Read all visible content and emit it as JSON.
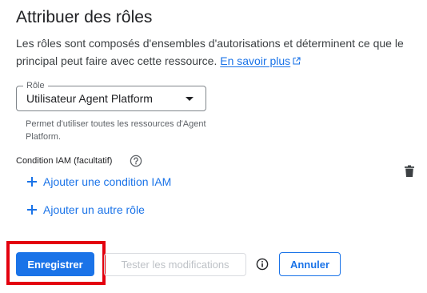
{
  "dialog": {
    "title": "Attribuer des rôles",
    "description": "Les rôles sont composés d'ensembles d'autorisations et déterminent ce que le principal peut faire avec cette ressource.",
    "learn_more_label": "En savoir plus",
    "learn_more_icon": "open-in-new-icon"
  },
  "role_select": {
    "label": "Rôle",
    "value": "Utilisateur Agent Platform",
    "hint": "Permet d'utiliser toutes les ressources d'Agent Platform.",
    "caret_icon": "dropdown-arrow-icon"
  },
  "condition": {
    "label": "Condition IAM (facultatif)",
    "help_icon": "help-circle-icon",
    "add_condition_label": "Ajouter une condition IAM",
    "delete_icon": "trash-icon"
  },
  "add_role": {
    "label": "Ajouter un autre rôle"
  },
  "actions": {
    "save_label": "Enregistrer",
    "test_label": "Tester les modifications",
    "info_icon": "info-icon",
    "cancel_label": "Annuler"
  },
  "colors": {
    "primary": "#1a73e8",
    "highlight": "#e3000f",
    "text": "#202124",
    "secondary_text": "#5f6368",
    "disabled": "#bdc1c6"
  }
}
